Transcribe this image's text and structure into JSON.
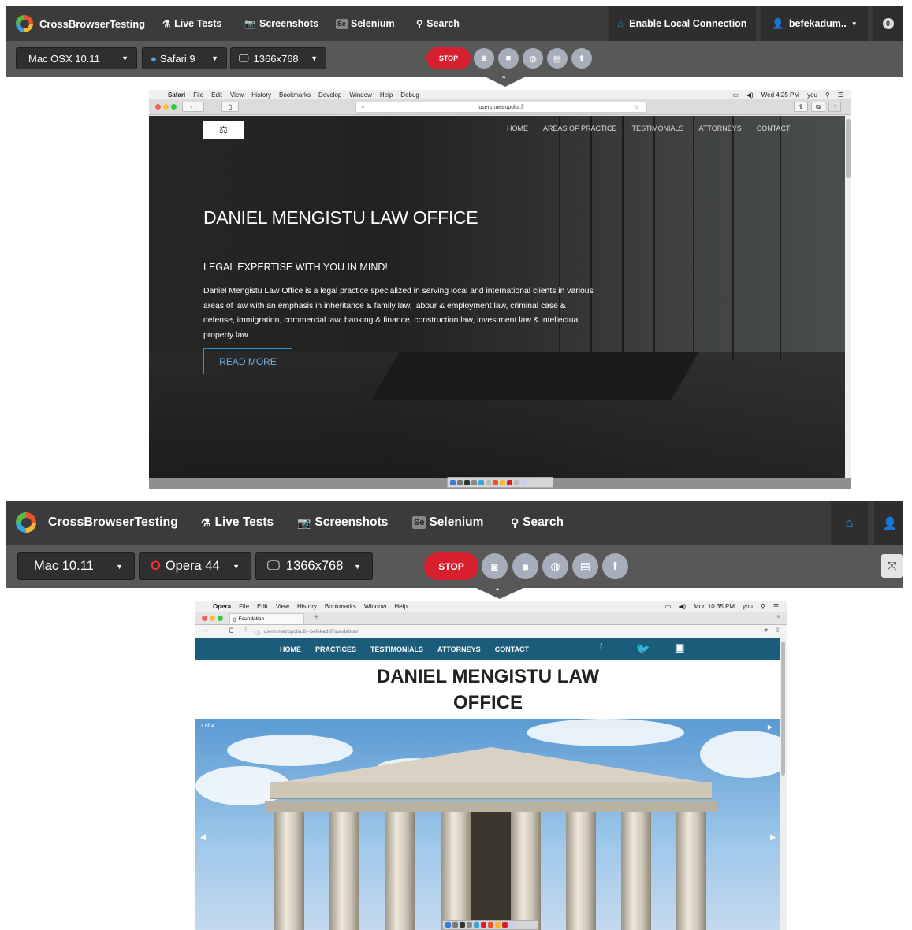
{
  "panel1": {
    "brand": "CrossBrowserTesting",
    "nav": [
      "Live Tests",
      "Screenshots",
      "Selenium",
      "Search"
    ],
    "enable_local": "Enable Local Connection",
    "user": "befekadum..",
    "notif_count": "0",
    "os": "Mac OSX 10.11",
    "browser": "Safari 9",
    "resolution": "1366x768",
    "stop": "STOP",
    "mac_menu": [
      "Safari",
      "File",
      "Edit",
      "View",
      "History",
      "Bookmarks",
      "Develop",
      "Window",
      "Help",
      "Debug"
    ],
    "mac_time": "Wed 4:25 PM",
    "mac_user": "you",
    "url": "users.metropolia.fi",
    "site": {
      "nav": [
        "HOME",
        "AREAS OF PRACTICE",
        "TESTIMONIALS",
        "ATTORNEYS",
        "CONTACT"
      ],
      "title": "DANIEL MENGISTU LAW OFFICE",
      "subtitle": "LEGAL EXPERTISE WITH YOU IN MIND!",
      "body": "Daniel Mengistu Law Office is a legal practice specialized in serving local and international clients in various areas of law with an emphasis in inheritance & family law, labour & employment law, criminal case & defense, immigration, commercial law, banking & finance, construction law, investment law & intellectual property law",
      "button": "READ MORE"
    }
  },
  "panel2": {
    "brand": "CrossBrowserTesting",
    "nav": [
      "Live Tests",
      "Screenshots",
      "Selenium",
      "Search"
    ],
    "os": "Mac 10.11",
    "browser": "Opera 44",
    "resolution": "1366x768",
    "stop": "STOP",
    "mac_menu": [
      "Opera",
      "File",
      "Edit",
      "View",
      "History",
      "Bookmarks",
      "Window",
      "Help"
    ],
    "mac_time": "Mon 10:35 PM",
    "mac_user": "you",
    "tab": "Foundation",
    "url": "users.metropolia.fi/~befekadt/Foundation/",
    "site": {
      "nav": [
        "HOME",
        "PRACTICES",
        "TESTIMONIALS",
        "ATTORNEYS",
        "CONTACT"
      ],
      "title_line1": "DANIEL MENGISTU LAW",
      "title_line2": "OFFICE",
      "slide_counter": "1 of 4"
    }
  },
  "colors": {
    "topbar": "#3b3b3b",
    "ctrlbar": "#585858",
    "stop": "#d6202d",
    "accent_blue": "#2a8fd9",
    "teal_nav": "#1b5c7a"
  }
}
